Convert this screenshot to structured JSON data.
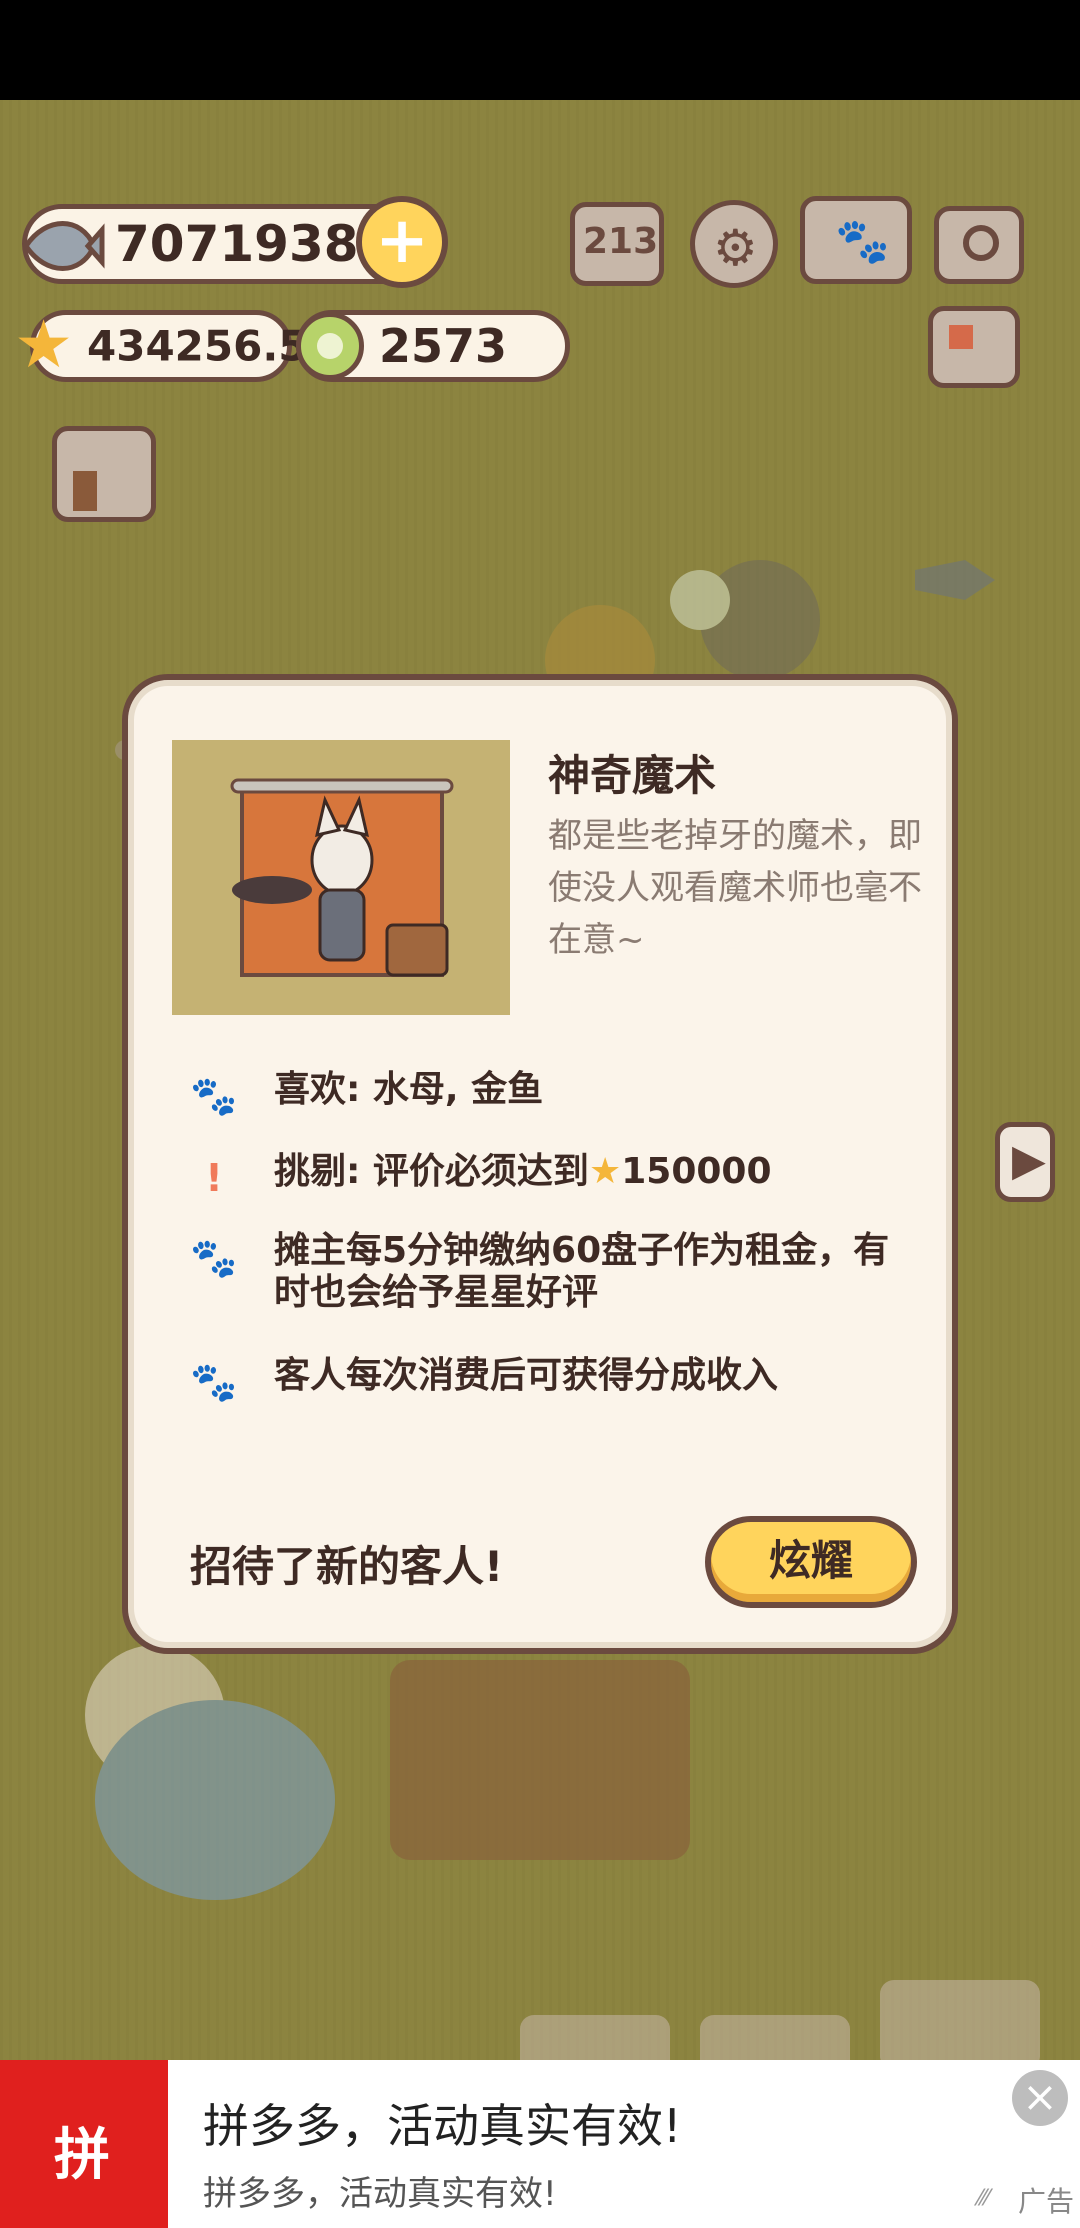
{
  "hud": {
    "fish_count": "70719388",
    "star_rating": "434256.5",
    "plate_count": "2573"
  },
  "icons": {
    "fish": "fish-icon",
    "plus": "plus-icon",
    "star": "star-icon",
    "plate": "plate-icon",
    "ranking": "ranking-icon",
    "settings": "gear-icon",
    "book": "paw-book-icon",
    "camera": "camera-icon",
    "news": "newspaper-icon",
    "shop": "shop-icon"
  },
  "dialog": {
    "title": "神奇魔术",
    "description": "都是些老掉牙的魔术，即使没人观看魔术师也毫不在意~",
    "rows": [
      {
        "icon": "paw-icon",
        "text": "喜欢: 水母, 金鱼"
      },
      {
        "icon": "exclamation-icon",
        "text": "挑剔: 评价必须达到",
        "value": "150000"
      },
      {
        "icon": "paw-icon",
        "text": "摊主每5分钟缴纳60盘子作为租金，有时也会给予星星好评"
      },
      {
        "icon": "paw-icon",
        "text": "客人每次消费后可获得分成收入"
      }
    ],
    "footer": "招待了新的客人!",
    "button": "炫耀"
  },
  "ad": {
    "title": "拼多多，活动真实有效!",
    "subtitle": "拼多多，活动真实有效!",
    "label": "广告",
    "logo_text": "拼"
  },
  "colors": {
    "background": "#8c8440",
    "outline": "#6b4a3f",
    "panel": "#fbf4ea",
    "button": "#ffd45c",
    "ad_logo": "#e0201e"
  }
}
